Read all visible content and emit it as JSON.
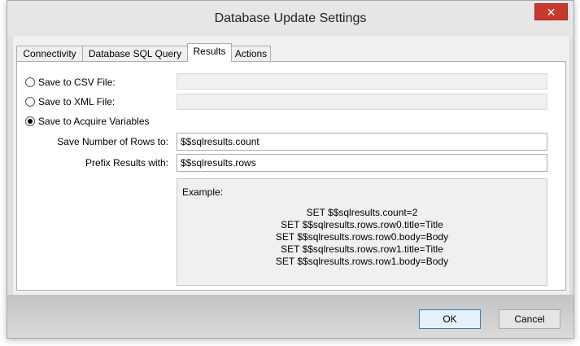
{
  "window": {
    "title": "Database Update Settings",
    "close_glyph": "✕"
  },
  "tabs": [
    {
      "label": "Connectivity",
      "active": false
    },
    {
      "label": "Database SQL Query",
      "active": false
    },
    {
      "label": "Results",
      "active": true
    },
    {
      "label": "Actions",
      "active": false
    }
  ],
  "results": {
    "csv_label": "Save to CSV File:",
    "csv_value": "",
    "xml_label": "Save to XML File:",
    "xml_value": "",
    "acquire_label": "Save to Acquire Variables",
    "selected_option": "acquire",
    "rows_count_label": "Save Number of Rows to:",
    "rows_count_value": "$$sqlresults.count",
    "prefix_label": "Prefix Results with:",
    "prefix_value": "$$sqlresults.rows",
    "example_label": "Example:",
    "example_lines": [
      "SET $$sqlresults.count=2",
      "SET $$sqlresults.rows.row0.title=Title",
      "SET $$sqlresults.rows.row0.body=Body",
      "SET $$sqlresults.rows.row1.title=Title",
      "SET $$sqlresults.rows.row1.body=Body"
    ]
  },
  "buttons": {
    "ok": "OK",
    "cancel": "Cancel"
  }
}
